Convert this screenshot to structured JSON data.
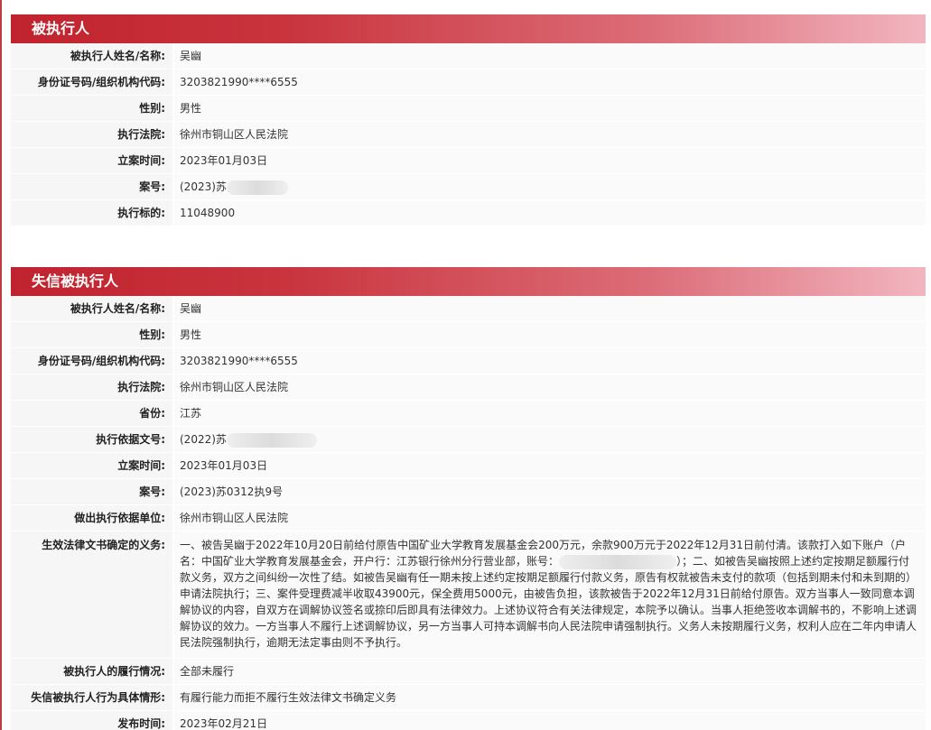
{
  "sec1": {
    "title": "被执行人",
    "rows": [
      {
        "label": "被执行人姓名/名称:",
        "value": "吴幽"
      },
      {
        "label": "身份证号码/组织机构代码:",
        "value": "3203821990****6555"
      },
      {
        "label": "性别:",
        "value": "男性"
      },
      {
        "label": "执行法院:",
        "value": "徐州市铜山区人民法院"
      },
      {
        "label": "立案时间:",
        "value": "2023年01月03日"
      },
      {
        "label": "案号:",
        "value": "(2023)苏"
      },
      {
        "label": "执行标的:",
        "value": "11048900"
      }
    ]
  },
  "sec2": {
    "title": "失信被执行人",
    "rows": [
      {
        "label": "被执行人姓名/名称:",
        "value": "吴幽"
      },
      {
        "label": "性别:",
        "value": "男性"
      },
      {
        "label": "身份证号码/组织机构代码:",
        "value": "3203821990****6555"
      },
      {
        "label": "执行法院:",
        "value": "徐州市铜山区人民法院"
      },
      {
        "label": "省份:",
        "value": "江苏"
      },
      {
        "label": "执行依据文号:",
        "value": "(2022)苏"
      },
      {
        "label": "立案时间:",
        "value": "2023年01月03日"
      },
      {
        "label": "案号:",
        "value": "(2023)苏0312执9号"
      },
      {
        "label": "做出执行依据单位:",
        "value": "徐州市铜山区人民法院"
      },
      {
        "label": "生效法律文书确定的义务:",
        "value_a": "一、被告吴幽于2022年10月20日前给付原告中国矿业大学教育发展基金会200万元，余款900万元于2022年12月31日前付清。该款打入如下账户（户名：中国矿业大学教育发展基金会，开户行：江苏银行徐州分行营业部，账号：",
        "value_b": "）；二、如被告吴幽按照上述约定按期足额履行付款义务，双方之间纠纷一次性了结。如被告吴幽有任一期未按上述约定按期足额履行付款义务，原告有权就被告未支付的款项（包括到期未付和未到期的）申请法院执行；三、案件受理费减半收取43900元，保全费用5000元，由被告负担，该款被告于2022年12月31日前给付原告。双方当事人一致同意本调解协议的内容，自双方在调解协议签名或捺印后即具有法律效力。上述协议符合有关法律规定，本院予以确认。当事人拒绝签收本调解书的，不影响上述调解协议的效力。一方当事人不履行上述调解协议，另一方当事人可持本调解书向人民法院申请强制执行。义务人未按期履行义务，权利人应在二年内申请人民法院强制执行，逾期无法定事由则不予执行。"
      },
      {
        "label": "被执行人的履行情况:",
        "value": "全部未履行"
      },
      {
        "label": "失信被执行人行为具体情形:",
        "value": "有履行能力而拒不履行生效法律文书确定义务"
      },
      {
        "label": "发布时间:",
        "value": "2023年02月21日"
      }
    ]
  }
}
